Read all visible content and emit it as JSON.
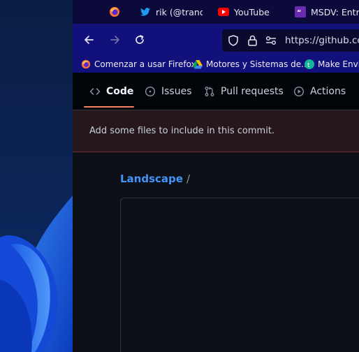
{
  "tabs": [
    {
      "title": "",
      "icon": "firefox-icon"
    },
    {
      "title": "rik (@tranqu",
      "icon": "twitter-icon"
    },
    {
      "title": "YouTube",
      "icon": "youtube-icon"
    },
    {
      "title": "MSDV: Entre",
      "icon": "msdv-icon"
    }
  ],
  "address_bar": {
    "url": "https://github.con"
  },
  "bookmarks": [
    {
      "label": "Comenzar a usar Firefox",
      "icon": "firefox-icon"
    },
    {
      "label": "Motores y Sistemas de...",
      "icon": "google-drive-icon"
    },
    {
      "label": "Make Envir",
      "icon": "teal-circle-icon"
    }
  ],
  "repo_nav": {
    "tabs": [
      {
        "label": "Code",
        "icon": "code-icon",
        "active": true
      },
      {
        "label": "Issues",
        "icon": "issue-icon",
        "active": false
      },
      {
        "label": "Pull requests",
        "icon": "pull-request-icon",
        "active": false
      },
      {
        "label": "Actions",
        "icon": "actions-play-icon",
        "active": false
      }
    ]
  },
  "flash": {
    "message": "Add some files to include in this commit."
  },
  "breadcrumb": {
    "repo": "Landscape",
    "separator": "/"
  },
  "colors": {
    "accent_blue": "#4493f8",
    "active_underline": "#f78166",
    "flash_border": "#6e2c32",
    "tabstrip_bg": "#0c0a3a",
    "toolbar_bg": "#12107a"
  }
}
